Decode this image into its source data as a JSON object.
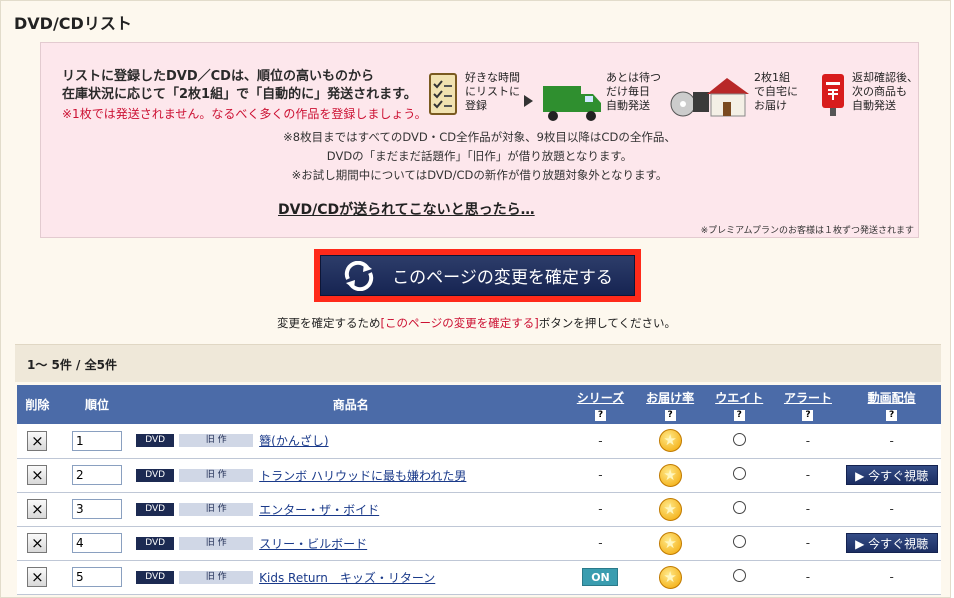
{
  "page_title": "DVD/CDリスト",
  "notice": {
    "headline_1": "リストに登録したDVD／CDは、順位の高いものから",
    "headline_2": "在庫状況に応じて「2枚1組」で「自動的に」発送されます。",
    "warning": "※1枚では発送されません。なるべく多くの作品を登録しましょう。",
    "flow": [
      {
        "icon": "checklist-icon",
        "text_1": "好きな時間",
        "text_2": "にリストに",
        "text_3": "登録"
      },
      {
        "icon": "truck-icon",
        "text_1": "あとは待つ",
        "text_2": "だけ毎日",
        "text_3": "自動発送"
      },
      {
        "icon": "house-icon",
        "text_1": "2枚1組",
        "text_2": "で自宅に",
        "text_3": "お届け"
      },
      {
        "icon": "postbox-icon",
        "text_1": "返却確認後、",
        "text_2": "次の商品も",
        "text_3": "自動発送"
      }
    ],
    "note_1": "※8枚目まではすべてのDVD・CD全作品が対象、9枚目以降はCDの全作品、",
    "note_2": "DVDの「まだまだ話題作」「旧作」が借り放題となります。",
    "note_3": "※お試し期間中についてはDVD/CDの新作が借り放題対象外となります。",
    "link": "DVD/CDが送られてこないと思ったら…",
    "premium_note": "※プレミアムプランのお客様は１枚ずつ発送されます"
  },
  "confirm_button": "このページの変更を確定する",
  "help": {
    "prefix": "変更を確定するため",
    "highlight": "[このページの変更を確定する]",
    "suffix": "ボタンを押してください。"
  },
  "count": "1〜 5件 / 全5件",
  "table": {
    "headers": {
      "delete": "削除",
      "rank": "順位",
      "title": "商品名",
      "series": "シリーズ",
      "delivery": "お届け率",
      "weight": "ウエイト",
      "alert": "アラート",
      "video": "動画配信"
    },
    "help_mark": "?",
    "rows": [
      {
        "rank": "1",
        "format": "DVD",
        "category": "旧 作",
        "title": "簪(かんざし)",
        "series": "-",
        "alert": "-",
        "video": "-"
      },
      {
        "rank": "2",
        "format": "DVD",
        "category": "旧 作",
        "title": "トランボ ハリウッドに最も嫌われた男",
        "series": "-",
        "alert": "-",
        "video": "▶ 今すぐ視聴"
      },
      {
        "rank": "3",
        "format": "DVD",
        "category": "旧 作",
        "title": "エンター・ザ・ボイド",
        "series": "-",
        "alert": "-",
        "video": "-"
      },
      {
        "rank": "4",
        "format": "DVD",
        "category": "旧 作",
        "title": "スリー・ビルボード",
        "series": "-",
        "alert": "-",
        "video": "▶ 今すぐ視聴"
      },
      {
        "rank": "5",
        "format": "DVD",
        "category": "旧 作",
        "title": "Kids Return　キッズ・リターン",
        "series": "ON",
        "alert": "-",
        "video": "-"
      }
    ]
  }
}
